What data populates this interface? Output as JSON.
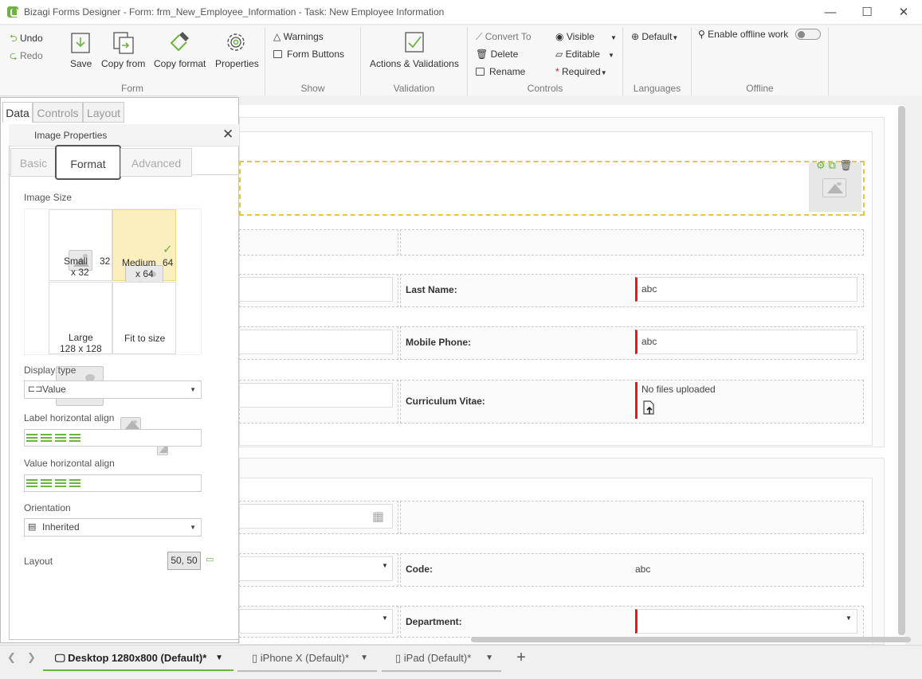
{
  "window": {
    "title": "Bizagi Forms Designer  - Form: frm_New_Employee_Information - Task:  New Employee Information",
    "minimize": "—",
    "maximize": "☐",
    "close": "✕"
  },
  "ribbon": {
    "undo": "Undo",
    "redo": "Redo",
    "save": "Save",
    "copy_from": "Copy from",
    "copy_format": "Copy format",
    "properties": "Properties",
    "group_form": "Form",
    "warnings": "Warnings",
    "form_buttons": "Form Buttons",
    "group_show": "Show",
    "actions_validations": "Actions & Validations",
    "group_validation": "Validation",
    "convert_to": "Convert To",
    "delete": "Delete",
    "rename": "Rename",
    "visible": "Visible",
    "editable": "Editable",
    "required": "Required",
    "group_controls": "Controls",
    "language": "Default",
    "group_languages": "Languages",
    "offline": "Enable offline work",
    "group_offline": "Offline"
  },
  "panel": {
    "tabs": [
      "Data",
      "Controls",
      "Layout"
    ],
    "dialog_title": "Image Properties",
    "dialog_close": "✕",
    "subtabs": [
      "Basic",
      "Format",
      "Advanced"
    ],
    "image_size_label": "Image Size",
    "sizes": {
      "small": {
        "name": "Small",
        "dim1": "32",
        "dim2": "x 32"
      },
      "medium": {
        "name": "Medium",
        "dim1": "64",
        "dim2": "x 64"
      },
      "large": {
        "name": "Large",
        "dim2": "128 x 128"
      },
      "fit": {
        "name": "Fit to size"
      }
    },
    "display_type_label": "Display type",
    "display_type_value": "Value",
    "label_align_label": "Label horizontal align",
    "value_align_label": "Value horizontal align",
    "orientation_label": "Orientation",
    "orientation_value": "Inherited",
    "layout_label": "Layout",
    "layout_value": "50, 50"
  },
  "form": {
    "last_name_label": "Last Name:",
    "last_name_value": "abc",
    "mobile_phone_label": "Mobile Phone:",
    "mobile_phone_value": "abc",
    "cv_label": "Curriculum Vitae:",
    "cv_value": "No files uploaded",
    "code_label": "Code:",
    "code_value": "abc",
    "department_label": "Department:"
  },
  "bottom_tabs": [
    {
      "label": "Desktop 1280x800 (Default)",
      "mark": "*"
    },
    {
      "label": "iPhone X (Default)",
      "mark": "*"
    },
    {
      "label": "iPad (Default)",
      "mark": "*"
    }
  ],
  "add_tab": "+",
  "colors": {
    "accent": "#6cb33f",
    "required": "#e21a1a",
    "selected_bg": "#fbefc0"
  }
}
